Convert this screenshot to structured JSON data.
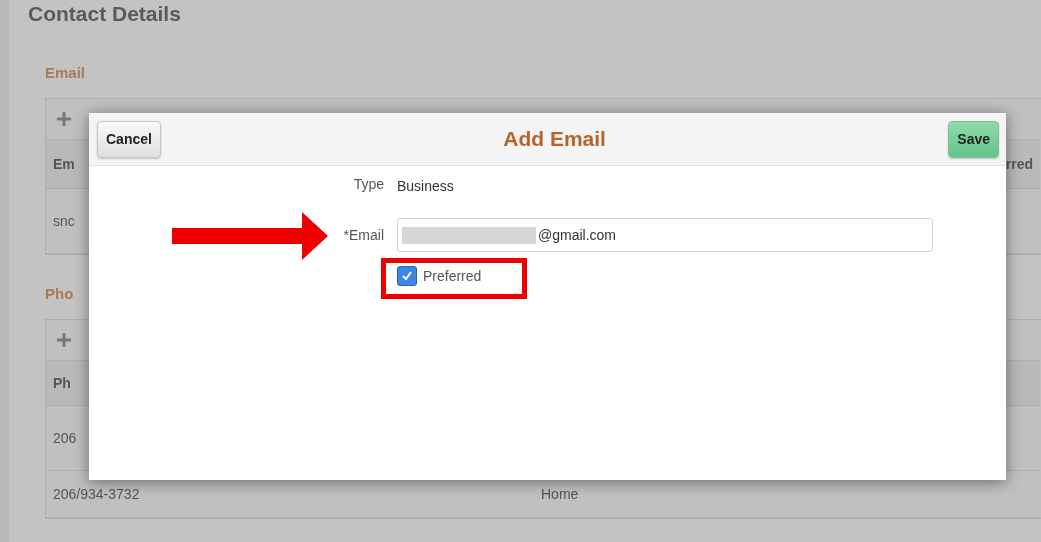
{
  "page": {
    "title": "Contact Details",
    "email_section": {
      "heading": "Email",
      "columns": [
        "Em",
        "rred"
      ],
      "rows": [
        [
          "snc"
        ]
      ]
    },
    "phone_section": {
      "heading": "Pho",
      "columns": [
        "Ph"
      ],
      "rows": [
        [
          "206",
          ""
        ],
        [
          "206/934-3732",
          "Home"
        ]
      ]
    }
  },
  "dialog": {
    "cancel": "Cancel",
    "title": "Add Email",
    "save": "Save",
    "type_label": "Type",
    "type_value": "Business",
    "email_label": "*Email",
    "email_value": "@gmail.com",
    "email_redacted": true,
    "preferred": {
      "label": "Preferred",
      "checked": true
    }
  }
}
